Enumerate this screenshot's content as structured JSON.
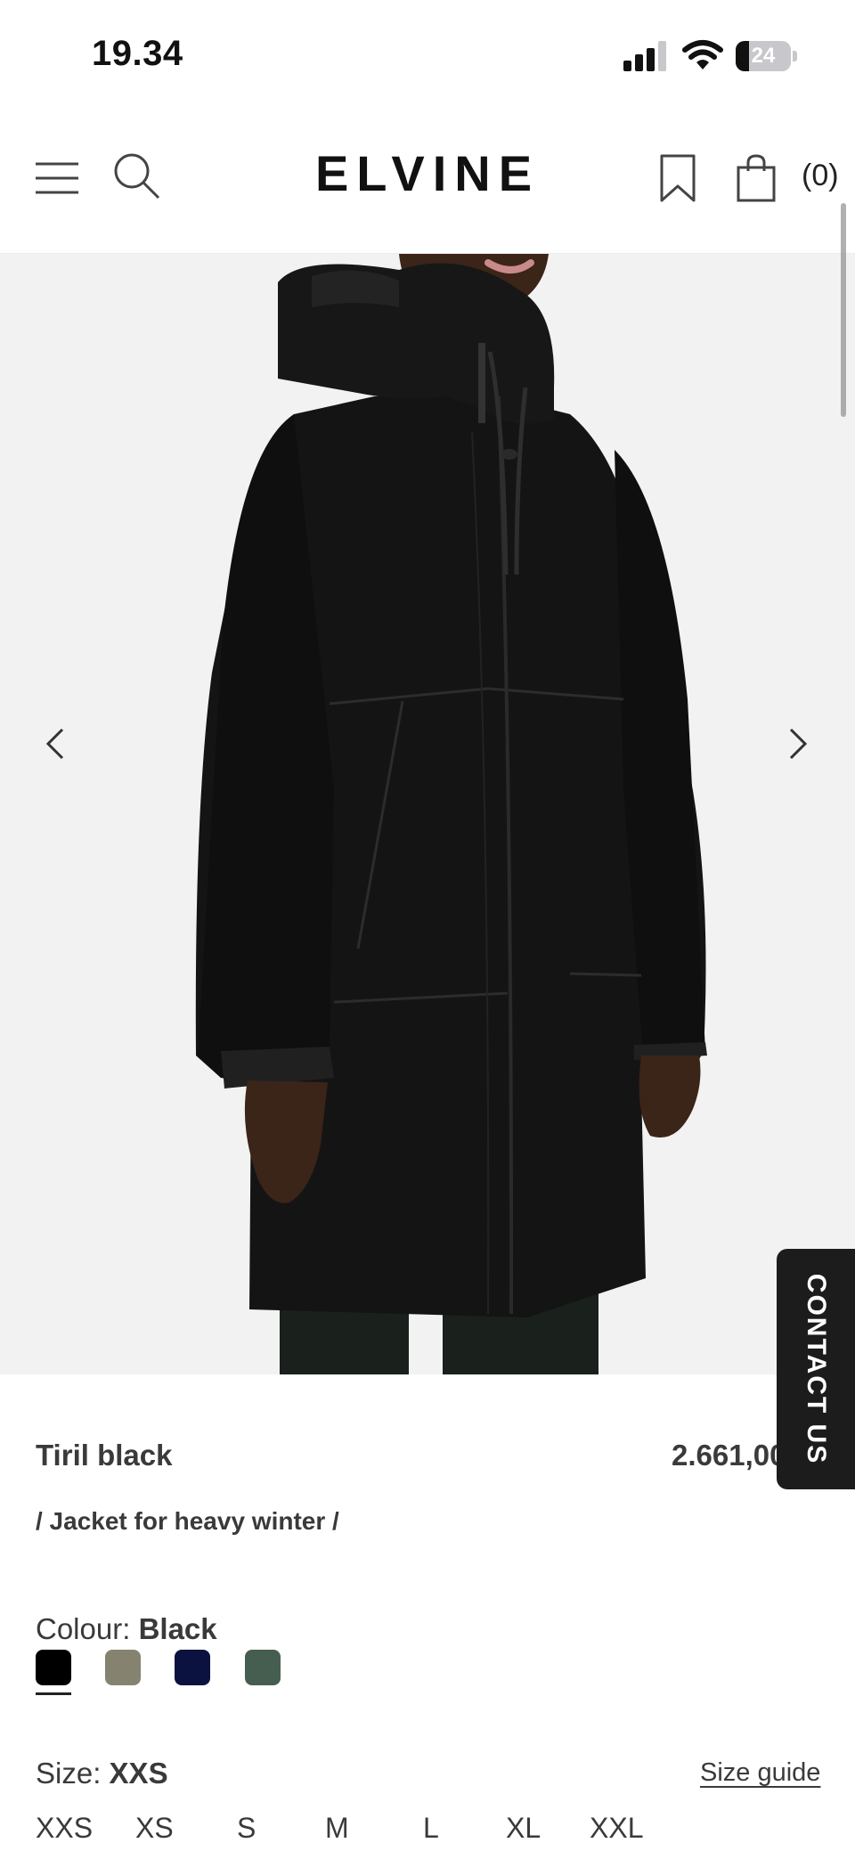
{
  "status_bar": {
    "time": "19.34",
    "battery": "24",
    "battery_level": 0.24
  },
  "header": {
    "logo": "ELVINE",
    "cart_count": "(0)"
  },
  "product": {
    "name": "Tiril black",
    "price": "2.661,00",
    "subtitle": "/ Jacket for heavy winter /"
  },
  "colour": {
    "label": "Colour:",
    "selected": "Black",
    "swatches": [
      "#000000",
      "#85836f",
      "#0c1240",
      "#465e4f"
    ]
  },
  "size": {
    "label": "Size:",
    "selected": "XXS",
    "guide": "Size guide",
    "options": [
      "XXS",
      "XS",
      "S",
      "M",
      "L",
      "XL",
      "XXL"
    ]
  },
  "contact": {
    "label": "CONTACT US"
  },
  "icons": {
    "menu": "menu-icon",
    "search": "search-icon",
    "bookmark": "bookmark-icon",
    "bag": "shopping-bag-icon",
    "prev": "chevron-left-icon",
    "next": "chevron-right-icon",
    "signal": "cellular-signal-icon",
    "wifi": "wifi-icon",
    "battery": "battery-icon"
  }
}
